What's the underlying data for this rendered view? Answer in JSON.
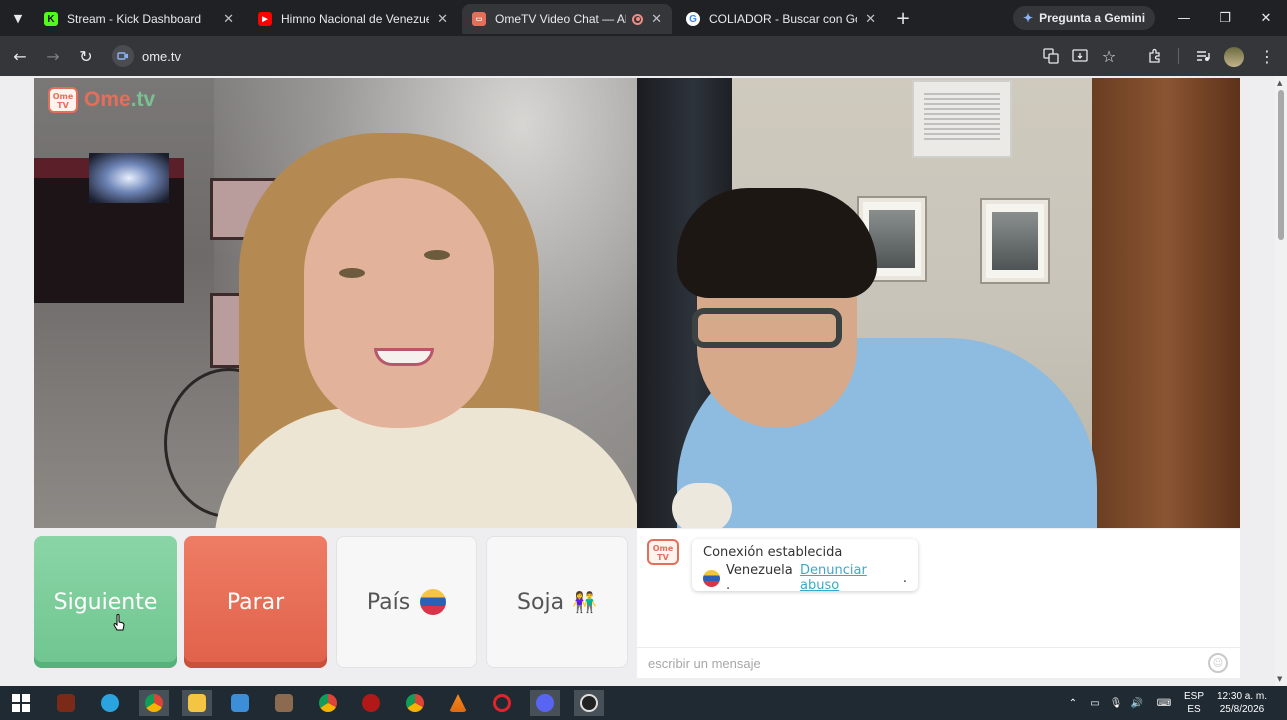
{
  "browser": {
    "tabs": [
      {
        "title": "Stream - Kick Dashboard",
        "favicon": "kick-icon",
        "color": "#53fc18"
      },
      {
        "title": "Himno Nacional de Venezuela",
        "favicon": "youtube-icon",
        "color": "#ff0000"
      },
      {
        "title": "OmeTV Video Chat — Alter",
        "favicon": "ometv-icon",
        "color": "#e56e5b",
        "active": true
      },
      {
        "title": "COLIADOR - Buscar con Google",
        "favicon": "google-icon",
        "color": "#4285f4"
      }
    ],
    "new_tab": "+",
    "gemini_label": "Pregunta a Gemini",
    "url": "ome.tv",
    "window_controls": [
      "—",
      "❐",
      "✕"
    ]
  },
  "app": {
    "logo_text": "Ome",
    "logo_dot": ".tv",
    "logo_badge": "Ome TV",
    "accent": "#e56e5b"
  },
  "controls": {
    "next_label": "Siguiente",
    "stop_label": "Parar",
    "country_label": "País",
    "gender_label": "Soja",
    "next_color": "#7ccc9b",
    "stop_color": "#e86c55"
  },
  "chat": {
    "status": "Conexión establecida",
    "country": "Venezuela .",
    "report_link": "Denunciar abuso",
    "report_suffix": ".",
    "input_placeholder": "escribir un mensaje"
  },
  "taskbar": {
    "lang_top": "ESP",
    "lang_bottom": "ES",
    "time": "12:30 a. m.",
    "date": "25/8/2026"
  }
}
